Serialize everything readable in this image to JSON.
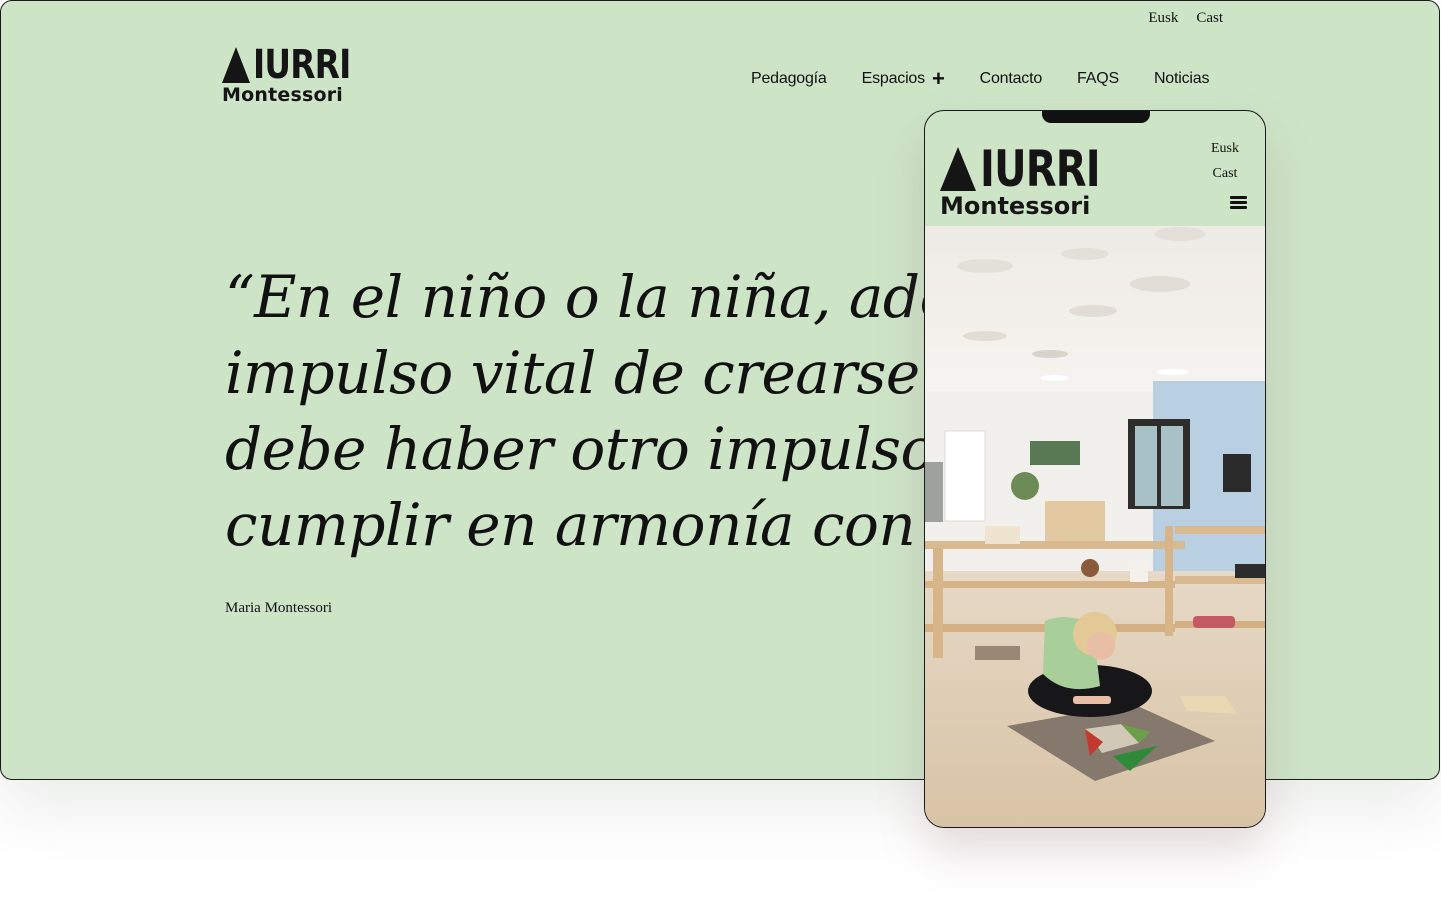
{
  "lang": {
    "eusk": "Eusk",
    "cast": "Cast"
  },
  "logo": {
    "wordmark": "IURRI",
    "sub": "Montessori"
  },
  "nav": [
    {
      "label": "Pedagogía"
    },
    {
      "label": "Espacios",
      "icon": "plus-icon"
    },
    {
      "label": "Contacto"
    },
    {
      "label": "FAQS"
    },
    {
      "label": "Noticias"
    }
  ],
  "quote": {
    "lines": [
      "“En el niño o la niña, además",
      "impulso vital de crearse a sí",
      "debe haber otro impulso, un",
      "cumplir en armonía con el u"
    ],
    "author": "Maria Montessori"
  },
  "mobile": {
    "lang": {
      "eusk": "Eusk",
      "cast": "Cast"
    },
    "logo": {
      "wordmark": "IURRI",
      "sub": "Montessori"
    },
    "menu_icon": "hamburger-menu-icon"
  },
  "colors": {
    "bg": "#cde4c7",
    "text": "#111111"
  }
}
